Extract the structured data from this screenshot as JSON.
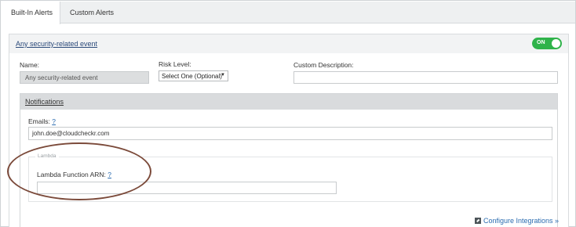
{
  "tabs": [
    {
      "label": "Built-In Alerts",
      "active": true
    },
    {
      "label": "Custom Alerts",
      "active": false
    }
  ],
  "alert": {
    "title": "Any security-related event",
    "toggle_label": "ON",
    "toggle_state": "on"
  },
  "form": {
    "name_label": "Name:",
    "name_value": "Any security-related event",
    "risk_label": "Risk Level:",
    "risk_value": "Select One (Optional)",
    "desc_label": "Custom Description:",
    "desc_value": ""
  },
  "notifications": {
    "title": "Notifications",
    "emails_label": "Emails:",
    "emails_help": "?",
    "emails_value": "john.doe@cloudcheckr.com",
    "lambda_legend": "Lambda",
    "lambda_label": "Lambda Function ARN:",
    "lambda_help": "?",
    "lambda_value": ""
  },
  "footer": {
    "configure_label": "Configure Integrations »"
  },
  "colors": {
    "toggle_on": "#2fb34a",
    "link": "#2b6cb0",
    "highlight": "#7b4a3a"
  },
  "icons": {
    "configure": "pencil-box-icon",
    "risk_dropdown": "caret-down-icon"
  }
}
